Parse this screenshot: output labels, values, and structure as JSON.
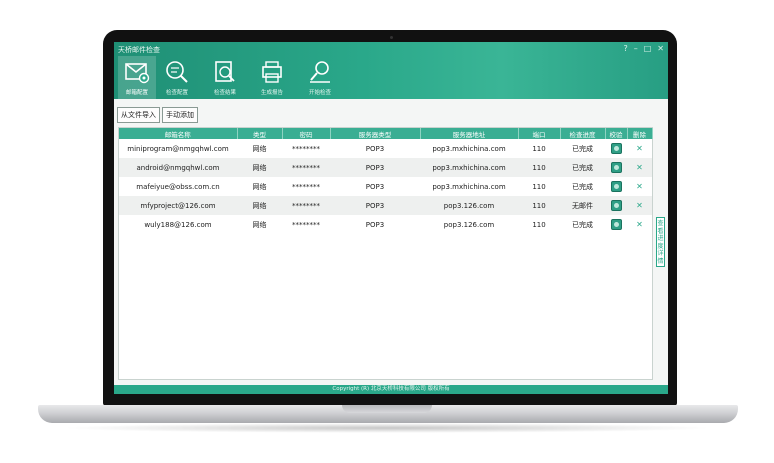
{
  "app": {
    "title": "天桥邮件检查"
  },
  "window_controls": [
    "?",
    "–",
    "□",
    "✕"
  ],
  "toolbar": [
    {
      "label": "邮箱配置",
      "icon": "mail-config-icon",
      "active": true
    },
    {
      "label": "检查配置",
      "icon": "check-config-icon",
      "active": false
    },
    {
      "label": "检查结果",
      "icon": "check-result-icon",
      "active": false
    },
    {
      "label": "生成报告",
      "icon": "report-icon",
      "active": false
    },
    {
      "label": "开始检查",
      "icon": "start-check-icon",
      "active": false
    }
  ],
  "buttons": {
    "import_label": "从文件导入",
    "manual_add_label": "手动添加"
  },
  "table": {
    "headers": [
      "邮箱名称",
      "类型",
      "密码",
      "服务器类型",
      "服务器地址",
      "端口",
      "检查进度",
      "校验",
      "删除"
    ],
    "rows": [
      {
        "email": "miniprogram@nmgqhwl.com",
        "type": "网络",
        "password": "********",
        "server_type": "POP3",
        "server_address": "pop3.mxhichina.com",
        "port": "110",
        "progress": "已完成"
      },
      {
        "email": "android@nmgqhwl.com",
        "type": "网络",
        "password": "********",
        "server_type": "POP3",
        "server_address": "pop3.mxhichina.com",
        "port": "110",
        "progress": "已完成"
      },
      {
        "email": "mafeiyue@obss.com.cn",
        "type": "网络",
        "password": "********",
        "server_type": "POP3",
        "server_address": "pop3.mxhichina.com",
        "port": "110",
        "progress": "已完成"
      },
      {
        "email": "mfyproject@126.com",
        "type": "网络",
        "password": "********",
        "server_type": "POP3",
        "server_address": "pop3.126.com",
        "port": "110",
        "progress": "无邮件"
      },
      {
        "email": "wuly188@126.com",
        "type": "网络",
        "password": "********",
        "server_type": "POP3",
        "server_address": "pop3.126.com",
        "port": "110",
        "progress": "已完成"
      }
    ]
  },
  "side_tab": {
    "label": "查看进度详情"
  },
  "footer": {
    "text": "Copyright (R) 北京天桥科技有限公司 版权所有"
  },
  "colors": {
    "accent": "#2aa88a",
    "header": "#3aae93",
    "verify": "#2f9f86"
  }
}
